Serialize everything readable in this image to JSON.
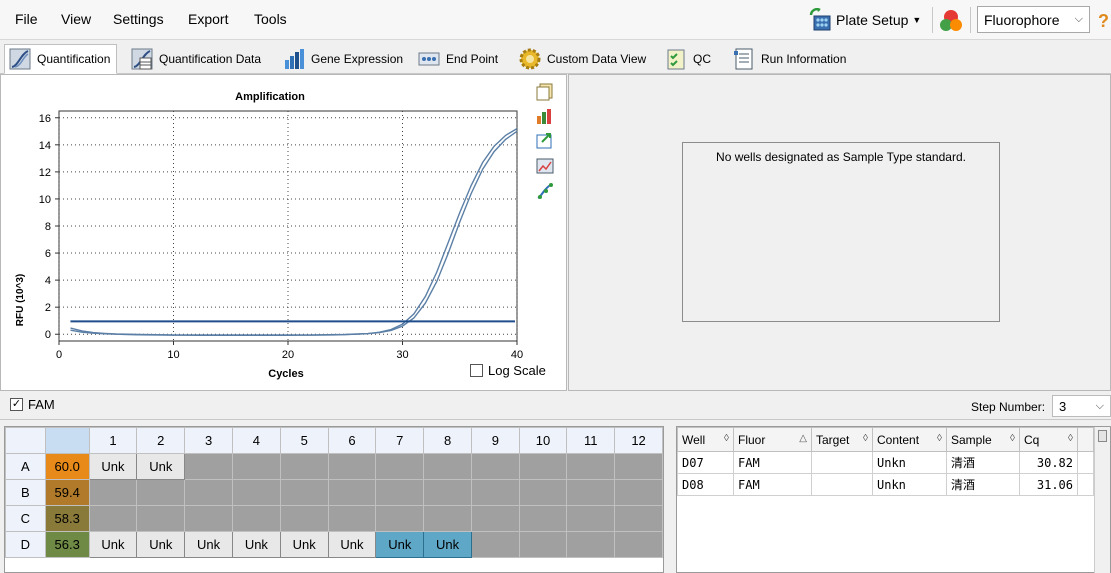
{
  "menu": {
    "file": "File",
    "view": "View",
    "settings": "Settings",
    "export": "Export",
    "tools": "Tools"
  },
  "toolbar": {
    "plate_setup": "Plate Setup",
    "fluorophore": "Fluorophore"
  },
  "tabs": [
    {
      "label": "Quantification"
    },
    {
      "label": "Quantification Data"
    },
    {
      "label": "Gene Expression"
    },
    {
      "label": "End Point"
    },
    {
      "label": "Custom Data View"
    },
    {
      "label": "QC"
    },
    {
      "label": "Run Information"
    }
  ],
  "chart_data": {
    "type": "line",
    "title": "Amplification",
    "xlabel": "Cycles",
    "ylabel": "RFU (10^3)",
    "xlim": [
      0,
      40
    ],
    "ylim": [
      -0.5,
      16.5
    ],
    "xticks": [
      0,
      10,
      20,
      30,
      40
    ],
    "yticks": [
      0,
      2,
      4,
      6,
      8,
      10,
      12,
      14,
      16
    ],
    "threshold": 0.95,
    "series": [
      {
        "x": [
          1,
          2,
          3,
          4,
          5,
          6,
          7,
          8,
          9,
          10,
          11,
          12,
          13,
          14,
          15,
          16,
          17,
          18,
          19,
          20,
          21,
          22,
          23,
          24,
          25,
          26,
          27,
          28,
          29,
          30,
          31,
          32,
          33,
          34,
          35,
          36,
          37,
          38,
          39,
          40
        ],
        "values": [
          0.3,
          0.15,
          0.08,
          0.03,
          0,
          -0.02,
          -0.04,
          -0.05,
          -0.06,
          -0.07,
          -0.07,
          -0.08,
          -0.08,
          -0.08,
          -0.08,
          -0.08,
          -0.08,
          -0.08,
          -0.08,
          -0.08,
          -0.07,
          -0.07,
          -0.06,
          -0.05,
          -0.03,
          0,
          0.05,
          0.15,
          0.35,
          0.75,
          1.5,
          2.8,
          4.6,
          6.8,
          9.0,
          11.0,
          12.7,
          13.9,
          14.7,
          15.2
        ]
      },
      {
        "x": [
          1,
          2,
          3,
          4,
          5,
          6,
          7,
          8,
          9,
          10,
          11,
          12,
          13,
          14,
          15,
          16,
          17,
          18,
          19,
          20,
          21,
          22,
          23,
          24,
          25,
          26,
          27,
          28,
          29,
          30,
          31,
          32,
          33,
          34,
          35,
          36,
          37,
          38,
          39,
          40
        ],
        "values": [
          0.45,
          0.25,
          0.12,
          0.06,
          0.02,
          0,
          -0.02,
          -0.03,
          -0.04,
          -0.05,
          -0.05,
          -0.05,
          -0.06,
          -0.06,
          -0.06,
          -0.06,
          -0.06,
          -0.06,
          -0.06,
          -0.06,
          -0.05,
          -0.05,
          -0.04,
          -0.03,
          -0.02,
          0.02,
          0.05,
          0.12,
          0.28,
          0.6,
          1.2,
          2.3,
          3.9,
          6.0,
          8.3,
          10.4,
          12.2,
          13.5,
          14.4,
          15.0
        ]
      }
    ],
    "log_scale": false,
    "grid": true
  },
  "log_scale_label": "Log Scale",
  "standard_message": "No wells designated as Sample Type standard.",
  "fam": {
    "label": "FAM",
    "checked": true
  },
  "step": {
    "label": "Step Number:",
    "value": "3"
  },
  "plate": {
    "columns": [
      "1",
      "2",
      "3",
      "4",
      "5",
      "6",
      "7",
      "8",
      "9",
      "10",
      "11",
      "12"
    ],
    "rows": [
      {
        "row": "A",
        "temp": "60.0",
        "temp_color": "#e88a1a",
        "cells": [
          "Unk",
          "Unk",
          "",
          "",
          "",
          "",
          "",
          "",
          "",
          "",
          "",
          ""
        ]
      },
      {
        "row": "B",
        "temp": "59.4",
        "temp_color": "#b07a2a",
        "cells": [
          "",
          "",
          "",
          "",
          "",
          "",
          "",
          "",
          "",
          "",
          "",
          ""
        ]
      },
      {
        "row": "C",
        "temp": "58.3",
        "temp_color": "#8a7a3a",
        "cells": [
          "",
          "",
          "",
          "",
          "",
          "",
          "",
          "",
          "",
          "",
          "",
          ""
        ]
      },
      {
        "row": "D",
        "temp": "56.3",
        "temp_color": "#6f8a45",
        "cells": [
          "Unk",
          "Unk",
          "Unk",
          "Unk",
          "Unk",
          "Unk",
          "Unk",
          "Unk",
          "",
          "",
          "",
          ""
        ]
      }
    ]
  },
  "results": {
    "headers": [
      "Well",
      "Fluor",
      "Target",
      "Content",
      "Sample",
      "Cq"
    ],
    "rows": [
      [
        "D07",
        "FAM",
        "",
        "Unkn",
        "清酒",
        "30.82"
      ],
      [
        "D08",
        "FAM",
        "",
        "Unkn",
        "清酒",
        "31.06"
      ]
    ]
  },
  "colors": {
    "curve": "#5b7fa6",
    "threshold": "#1f4e8c",
    "selected_well": "#5fa7c6"
  }
}
